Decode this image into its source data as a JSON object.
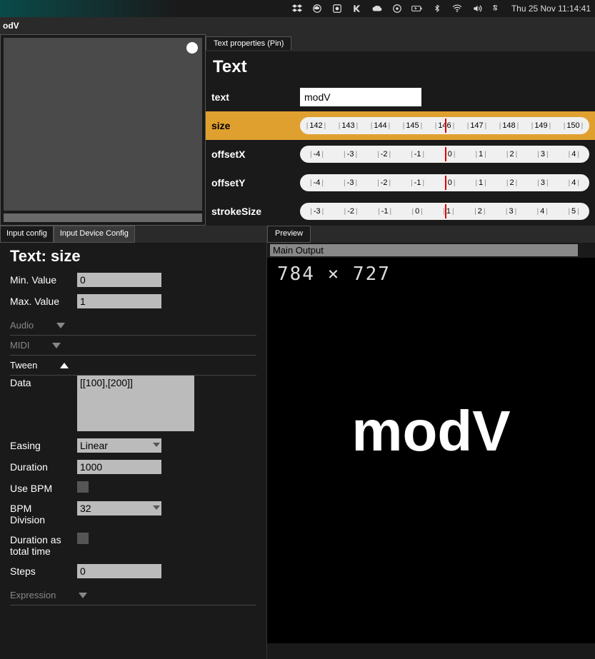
{
  "menubar": {
    "datetime": "Thu 25 Nov  11:14:41"
  },
  "titlebar": {
    "text": "odV"
  },
  "propertiesPanel": {
    "tab": "Text properties   (Pin)",
    "heading": "Text",
    "rows": {
      "text": {
        "label": "text",
        "value": "modV"
      },
      "size": {
        "label": "size",
        "ticks": [
          "142",
          "143",
          "144",
          "145",
          "146",
          "147",
          "148",
          "149",
          "150"
        ]
      },
      "offsetX": {
        "label": "offsetX",
        "ticks": [
          "-4",
          "-3",
          "-2",
          "-1",
          "0",
          "1",
          "2",
          "3",
          "4"
        ]
      },
      "offsetY": {
        "label": "offsetY",
        "ticks": [
          "-4",
          "-3",
          "-2",
          "-1",
          "0",
          "1",
          "2",
          "3",
          "4"
        ]
      },
      "strokeSize": {
        "label": "strokeSize",
        "ticks": [
          "-3",
          "-2",
          "-1",
          "0",
          "1",
          "2",
          "3",
          "4",
          "5"
        ]
      }
    }
  },
  "inputConfig": {
    "tabs": [
      "Input config",
      "Input Device Config"
    ],
    "heading": "Text: size",
    "min": {
      "label": "Min. Value",
      "value": "0"
    },
    "max": {
      "label": "Max. Value",
      "value": "1"
    },
    "audio": {
      "label": "Audio"
    },
    "midi": {
      "label": "MIDI"
    },
    "tween": {
      "label": "Tween"
    },
    "data": {
      "label": "Data",
      "value": "[[100],[200]]"
    },
    "easing": {
      "label": "Easing",
      "value": "Linear"
    },
    "duration": {
      "label": "Duration",
      "value": "1000"
    },
    "useBpm": {
      "label": "Use BPM"
    },
    "bpmDivision": {
      "label": "BPM Division",
      "value": "32"
    },
    "durationTotal": {
      "label": "Duration as total time"
    },
    "steps": {
      "label": "Steps",
      "value": "0"
    },
    "expression": {
      "label": "Expression"
    }
  },
  "preview": {
    "tab": "Preview",
    "outputLabel": "Main Output",
    "dimensions": "784  ×  727",
    "canvasText": "modV"
  }
}
